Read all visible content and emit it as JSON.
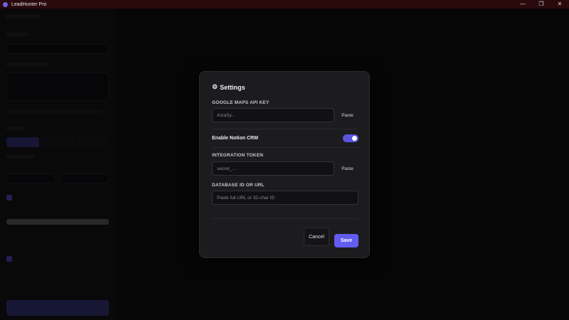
{
  "window": {
    "title": "LeadHunter Pro",
    "controls": {
      "minimize": "—",
      "maximize": "❐",
      "close": "✕"
    }
  },
  "modal": {
    "title_icon": "⚙",
    "title": "Settings",
    "google_maps": {
      "label": "GOOGLE MAPS API KEY",
      "placeholder": "AIzaSy...",
      "paste_label": "Paste"
    },
    "notion_toggle": {
      "label": "Enable Notion CRM",
      "enabled": true
    },
    "integration_token": {
      "label": "INTEGRATION TOKEN",
      "placeholder": "secret_...",
      "paste_label": "Paste"
    },
    "database_id": {
      "label": "DATABASE ID OR URL",
      "placeholder": "Paste full URL or 32-char ID"
    },
    "cancel_label": "Cancel",
    "save_label": "Save"
  },
  "colors": {
    "accent": "#635cf0",
    "titlebar": "#2a0a0c",
    "modal_bg": "#1c1c1f"
  }
}
